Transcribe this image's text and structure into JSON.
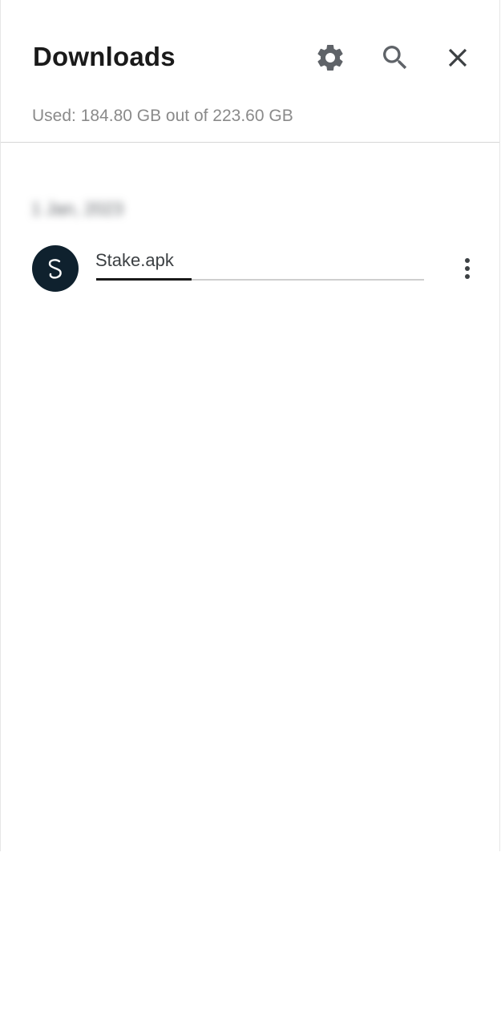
{
  "header": {
    "title": "Downloads",
    "settings_icon": "gear-icon",
    "search_icon": "search-icon",
    "close_icon": "close-icon",
    "storage_text": "Used: 184.80 GB out of 223.60 GB"
  },
  "downloads": {
    "groups": [
      {
        "date_label": "1 Jan, 2023",
        "items": [
          {
            "file_name": "Stake.apk",
            "icon": "stake-app-icon",
            "icon_color": "#0f212e",
            "progress": 0.29,
            "menu_icon": "more-vert-icon"
          }
        ]
      }
    ]
  },
  "colors": {
    "progress_fill": "#1a1a1a",
    "progress_track": "#cfcfcf",
    "icon_gray": "#5f6368"
  }
}
